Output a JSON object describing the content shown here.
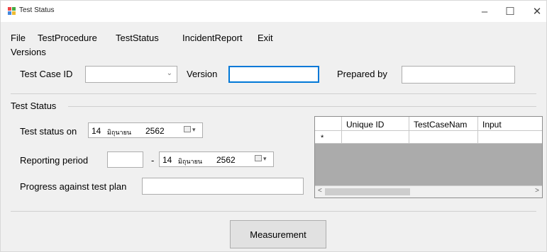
{
  "window": {
    "title": "Test Status",
    "controls": {
      "minimize": "–",
      "maximize": "☐",
      "close": "✕"
    }
  },
  "menu": {
    "items": [
      "File",
      "TestProcedure",
      "TestStatus",
      "IncidentReport",
      "Exit"
    ]
  },
  "versions": {
    "group_label": "Versions",
    "test_case_id_label": "Test Case ID",
    "test_case_id_value": "",
    "version_label": "Version",
    "version_value": "",
    "prepared_by_label": "Prepared by",
    "prepared_by_value": ""
  },
  "test_status": {
    "group_label": "Test Status",
    "test_status_on_label": "Test status on",
    "test_status_on_date": {
      "day": "14",
      "month": "มิถุนายน",
      "year": "2562"
    },
    "reporting_period_label": "Reporting period",
    "reporting_from_value": "",
    "reporting_dash": "-",
    "reporting_to_date": {
      "day": "14",
      "month": "มิถุนายน",
      "year": "2562"
    },
    "progress_label": "Progress against test plan",
    "progress_value": ""
  },
  "grid": {
    "columns": [
      "Unique ID",
      "TestCaseNam",
      "Input"
    ],
    "new_row_marker": "*",
    "scroll_left": "<",
    "scroll_right": ">"
  },
  "actions": {
    "measurement_label": "Measurement"
  }
}
